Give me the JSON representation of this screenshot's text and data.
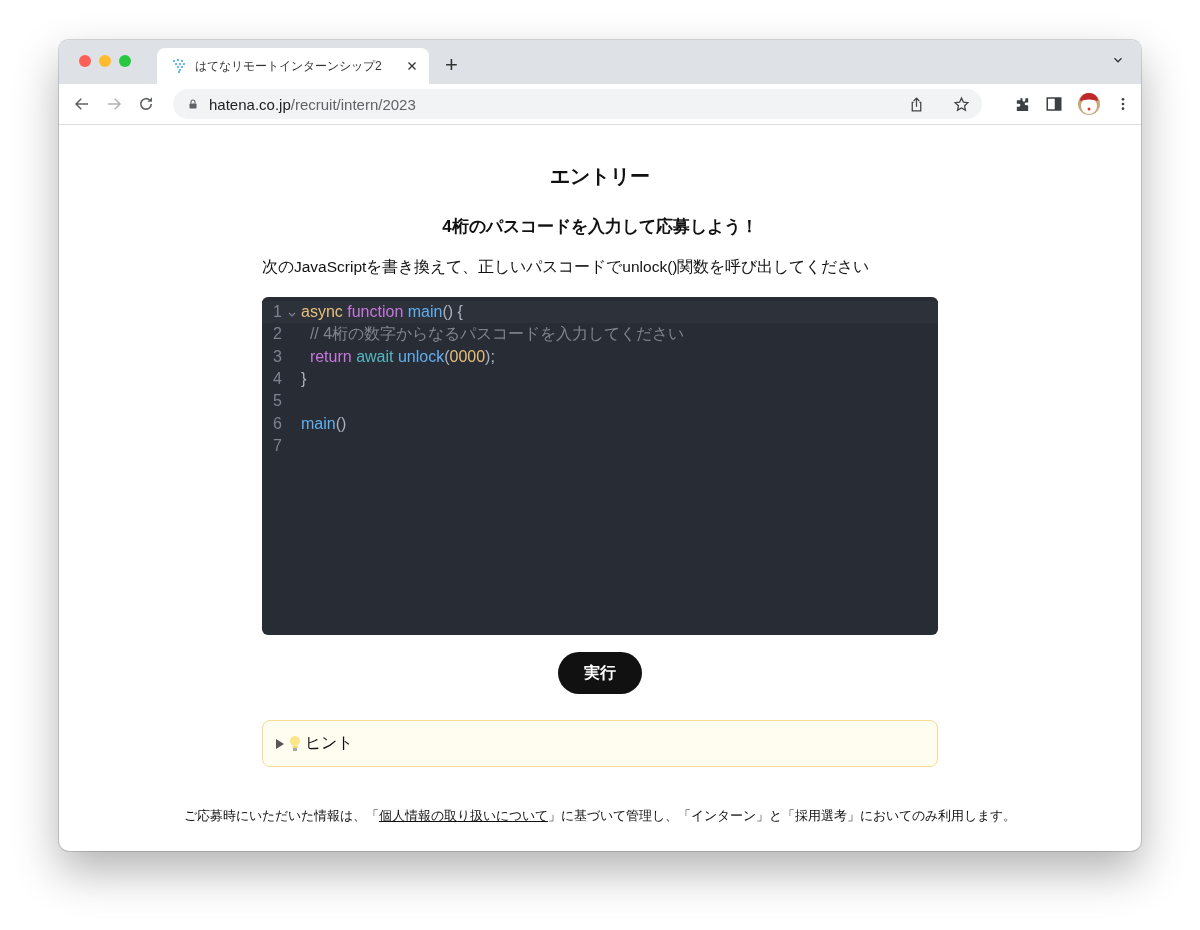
{
  "browser": {
    "tab": {
      "title": "はてなリモートインターンシップ2",
      "selected": true
    },
    "new_tab": "+",
    "url": {
      "domain": "hatena.co.jp",
      "path": "/recruit/intern/2023"
    }
  },
  "page": {
    "title": "エントリー",
    "subtitle": "4桁のパスコードを入力して応募しよう！",
    "instruction": "次のJavaScriptを書き換えて、正しいパスコードでunlock()関数を呼び出してください",
    "editor": {
      "lines": [
        {
          "number": "1",
          "foldable": true,
          "active": true,
          "tokens": [
            {
              "text": "async",
              "kind": "keyword"
            },
            {
              "text": " function",
              "kind": "storage"
            },
            {
              "text": " main",
              "kind": "function"
            },
            {
              "text": "() {",
              "kind": "plain"
            }
          ]
        },
        {
          "number": "2",
          "foldable": false,
          "active": false,
          "tokens": [
            {
              "text": "  // 4桁の数字からなるパスコードを入力してください",
              "kind": "comment"
            }
          ]
        },
        {
          "number": "3",
          "foldable": false,
          "active": false,
          "tokens": [
            {
              "text": "  return",
              "kind": "storage"
            },
            {
              "text": " await",
              "kind": "operator"
            },
            {
              "text": " unlock",
              "kind": "function"
            },
            {
              "text": "(",
              "kind": "plain"
            },
            {
              "text": "0000",
              "kind": "number"
            },
            {
              "text": ");",
              "kind": "plain"
            }
          ]
        },
        {
          "number": "4",
          "foldable": false,
          "active": false,
          "tokens": [
            {
              "text": "}",
              "kind": "plain"
            }
          ]
        },
        {
          "number": "5",
          "foldable": false,
          "active": false
        },
        {
          "number": "6",
          "foldable": false,
          "active": false,
          "tokens": [
            {
              "text": "main",
              "kind": "function"
            },
            {
              "text": "()",
              "kind": "plain"
            }
          ]
        },
        {
          "number": "7",
          "foldable": false,
          "active": false
        }
      ]
    },
    "run_button": "実行",
    "hint": {
      "label": "ヒント",
      "expanded": false
    },
    "notice": {
      "before": "ご応募時にいただいた情報は、「",
      "link": "個人情報の取り扱いについて",
      "after": "」に基づいて管理し、「インターン」と「採用選考」においてのみ利用します。"
    }
  }
}
